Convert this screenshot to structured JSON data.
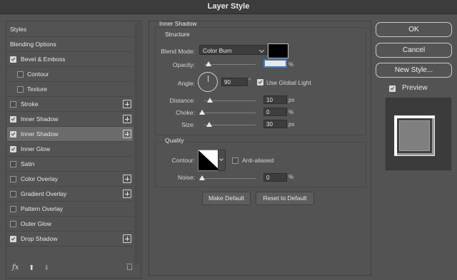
{
  "window": {
    "title": "Layer Style"
  },
  "left_panel": {
    "items": [
      {
        "label": "Styles",
        "checkbox": false,
        "checked": false,
        "plus": false,
        "selected": false,
        "indent": false
      },
      {
        "label": "Blending Options",
        "checkbox": false,
        "checked": false,
        "plus": false,
        "selected": false,
        "indent": false
      },
      {
        "label": "Bevel & Emboss",
        "checkbox": true,
        "checked": true,
        "plus": false,
        "selected": false,
        "indent": false
      },
      {
        "label": "Contour",
        "checkbox": true,
        "checked": false,
        "plus": false,
        "selected": false,
        "indent": true
      },
      {
        "label": "Texture",
        "checkbox": true,
        "checked": false,
        "plus": false,
        "selected": false,
        "indent": true
      },
      {
        "label": "Stroke",
        "checkbox": true,
        "checked": false,
        "plus": true,
        "selected": false,
        "indent": false
      },
      {
        "label": "Inner Shadow",
        "checkbox": true,
        "checked": true,
        "plus": true,
        "selected": false,
        "indent": false
      },
      {
        "label": "Inner Shadow",
        "checkbox": true,
        "checked": true,
        "plus": true,
        "selected": true,
        "indent": false
      },
      {
        "label": "Inner Glow",
        "checkbox": true,
        "checked": true,
        "plus": false,
        "selected": false,
        "indent": false
      },
      {
        "label": "Satin",
        "checkbox": true,
        "checked": false,
        "plus": false,
        "selected": false,
        "indent": false
      },
      {
        "label": "Color Overlay",
        "checkbox": true,
        "checked": false,
        "plus": true,
        "selected": false,
        "indent": false
      },
      {
        "label": "Gradient Overlay",
        "checkbox": true,
        "checked": false,
        "plus": true,
        "selected": false,
        "indent": false
      },
      {
        "label": "Pattern Overlay",
        "checkbox": true,
        "checked": false,
        "plus": false,
        "selected": false,
        "indent": false
      },
      {
        "label": "Outer Glow",
        "checkbox": true,
        "checked": false,
        "plus": false,
        "selected": false,
        "indent": false
      },
      {
        "label": "Drop Shadow",
        "checkbox": true,
        "checked": true,
        "plus": true,
        "selected": false,
        "indent": false
      }
    ],
    "footer": {
      "fx": "fx",
      "up_icon": "arrow-up-icon",
      "down_icon": "arrow-down-icon",
      "trash_icon": "trash-icon"
    }
  },
  "inner_shadow": {
    "title": "Inner Shadow",
    "structure_title": "Structure",
    "blend_mode_label": "Blend Mode:",
    "blend_mode_value": "Color Burn",
    "color": "#000000",
    "opacity_label": "Opacity:",
    "opacity_value": "",
    "opacity_unit": "%",
    "angle_label": "Angle:",
    "angle_value": "90",
    "angle_unit": "°",
    "global_light_label": "Use Global Light",
    "global_light_checked": true,
    "distance_label": "Distance:",
    "distance_value": "10",
    "distance_unit": "px",
    "choke_label": "Choke:",
    "choke_value": "0",
    "choke_unit": "%",
    "size_label": "Size:",
    "size_value": "30",
    "size_unit": "px",
    "quality_title": "Quality",
    "contour_label": "Contour:",
    "anti_aliased_label": "Anti-aliased",
    "anti_aliased_checked": false,
    "noise_label": "Noise:",
    "noise_value": "0",
    "noise_unit": "%",
    "make_default_label": "Make Default",
    "reset_default_label": "Reset to Default"
  },
  "right_panel": {
    "ok_label": "OK",
    "cancel_label": "Cancel",
    "new_style_label": "New Style...",
    "preview_label": "Preview",
    "preview_checked": true
  }
}
